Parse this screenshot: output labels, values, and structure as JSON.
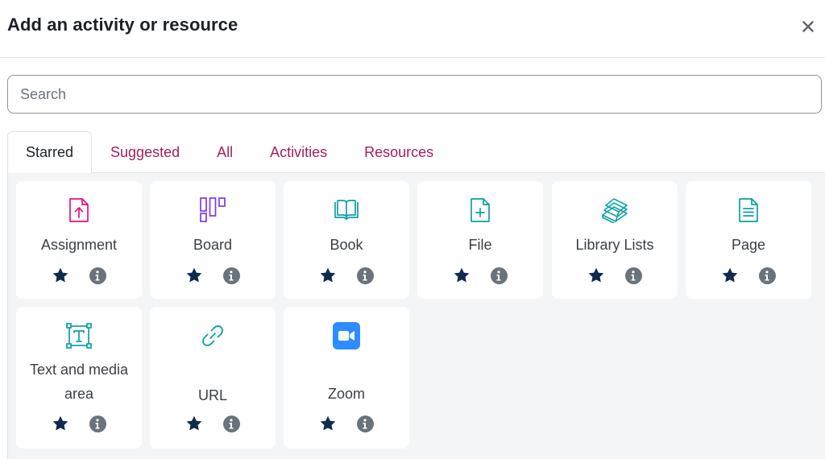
{
  "dialog": {
    "title": "Add an activity or resource"
  },
  "search": {
    "value": "",
    "placeholder": "Search"
  },
  "tabs": [
    {
      "label": "Starred",
      "active": true
    },
    {
      "label": "Suggested",
      "active": false
    },
    {
      "label": "All",
      "active": false
    },
    {
      "label": "Activities",
      "active": false
    },
    {
      "label": "Resources",
      "active": false
    }
  ],
  "items": [
    {
      "label": "Assignment",
      "icon": "assignment-icon",
      "starred": true
    },
    {
      "label": "Board",
      "icon": "board-icon",
      "starred": true
    },
    {
      "label": "Book",
      "icon": "book-icon",
      "starred": true
    },
    {
      "label": "File",
      "icon": "file-icon",
      "starred": true
    },
    {
      "label": "Library Lists",
      "icon": "library-lists-icon",
      "starred": true
    },
    {
      "label": "Page",
      "icon": "page-icon",
      "starred": true
    },
    {
      "label": "Text and media area",
      "icon": "text-media-icon",
      "starred": true
    },
    {
      "label": "URL",
      "icon": "url-link-icon",
      "starred": true
    },
    {
      "label": "Zoom",
      "icon": "zoom-video-icon",
      "starred": true
    }
  ],
  "colors": {
    "tab_link": "#a21f5b",
    "assignment": "#e2137c",
    "board": "#7c3aed",
    "content": "#0d9fa8",
    "zoom": "#2d8cff",
    "star": "#0f2a4f",
    "info": "#6a737b"
  }
}
